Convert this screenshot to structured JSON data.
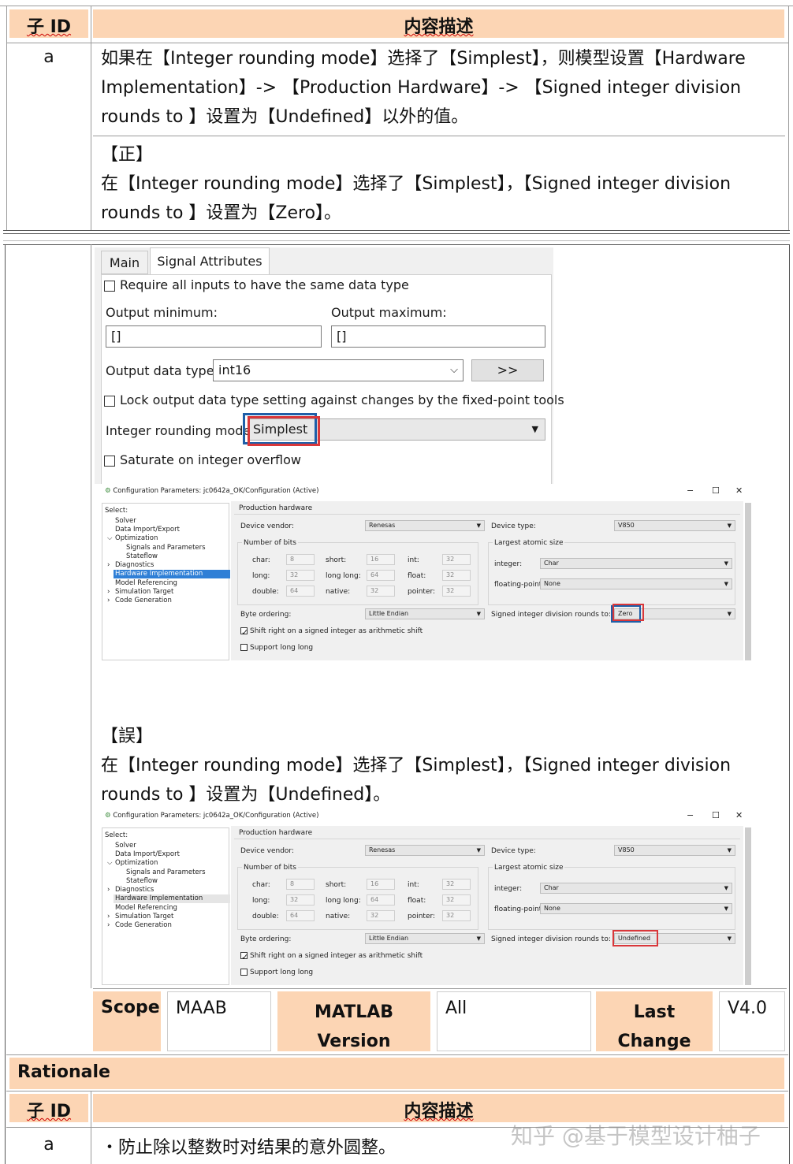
{
  "top_table": {
    "col_subid": "子 ID",
    "col_desc": "内容描述",
    "row_id": "a",
    "row_text": "如果在【Integer rounding mode】选择了【Simplest】，则模型设置【Hardware Implementation】-> 【Production Hardware】-> 【Signed integer division rounds to 】设置为【Undefined】以外的值。",
    "correct_label": "【正】",
    "correct_text": "在【Integer rounding mode】选择了【Simplest】，【Signed integer division rounds to 】设置为【Zero】。"
  },
  "block_dialog": {
    "tab_main": "Main",
    "tab_signal": "Signal Attributes",
    "require_same_type": "Require all inputs to have the same data type",
    "output_min_label": "Output minimum:",
    "output_max_label": "Output maximum:",
    "output_min_value": "[]",
    "output_max_value": "[]",
    "output_type_label": "Output data type:",
    "output_type_value": "int16",
    "assistant_button": ">>",
    "lock_label": "Lock output data type setting against changes by the fixed-point tools",
    "rounding_label": "Integer rounding mode:",
    "rounding_value": "Simplest",
    "saturate_label": "Saturate on integer overflow"
  },
  "config_common": {
    "title": "Configuration Parameters: jc0642a_OK/Configuration (Active)",
    "select_label": "Select:",
    "tree": [
      "Solver",
      "Data Import/Export",
      "Optimization",
      "Signals and Parameters",
      "Stateflow",
      "Diagnostics",
      "Hardware Implementation",
      "Model Referencing",
      "Simulation Target",
      "Code Generation"
    ],
    "section": "Production hardware",
    "vendor_label": "Device vendor:",
    "vendor_value": "Renesas",
    "type_label": "Device type:",
    "type_value": "V850",
    "bits_group": "Number of bits",
    "atomic_group": "Largest atomic size",
    "char_label": "char:",
    "char_value": "8",
    "short_label": "short:",
    "short_value": "16",
    "int_label": "int:",
    "int_value": "32",
    "long_label": "long:",
    "long_value": "32",
    "longlong_label": "long long:",
    "longlong_value": "64",
    "float_label": "float:",
    "float_value": "32",
    "double_label": "double:",
    "double_value": "64",
    "native_label": "native:",
    "native_value": "32",
    "pointer_label": "pointer:",
    "pointer_value": "32",
    "integer_label": "integer:",
    "integer_value": "Char",
    "floating_label": "floating-point:",
    "floating_value": "None",
    "byte_label": "Byte ordering:",
    "byte_value": "Little Endian",
    "division_label": "Signed integer division rounds to:",
    "shift_label": "Shift right on a signed integer as arithmetic shift",
    "longlong_support": "Support long long",
    "win_min": "−",
    "win_max": "☐",
    "win_close": "✕"
  },
  "config_good": {
    "division_value": "Zero"
  },
  "config_bad": {
    "division_value": "Undefined"
  },
  "wrong_label": "【誤】",
  "wrong_text": "在【Integer rounding mode】选择了【Simplest】，【Signed integer division rounds to 】设置为【Undefined】。",
  "meta_row": {
    "scope_label": "Scope",
    "scope_value": "MAAB",
    "matlab_label": "MATLAB Version",
    "matlab_value": "All",
    "last_label": "Last Change",
    "last_value": "V4.0"
  },
  "rationale": {
    "title": "Rationale",
    "col_subid": "子 ID",
    "col_desc": "内容描述",
    "row_id": "a",
    "row_text": "・防止除以整数时对结果的意外圆整。"
  },
  "watermark": "知乎 @基于模型设计柚子"
}
